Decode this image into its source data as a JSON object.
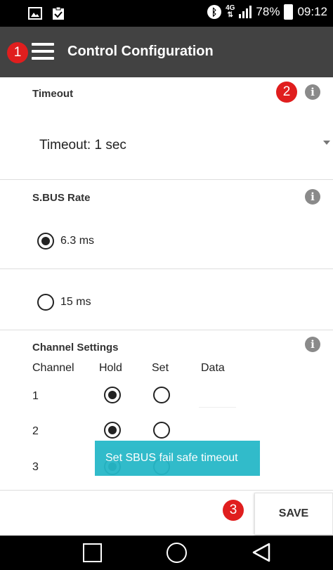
{
  "status_bar": {
    "left_icons": [
      "image-icon",
      "clipboard-check-icon"
    ],
    "bluetooth_icon": "bluetooth-icon",
    "network_label": "4G",
    "battery": "78%",
    "time": "09:12"
  },
  "app_bar": {
    "menu_icon": "hamburger-menu-icon",
    "title": "Control Configuration"
  },
  "markers": [
    "1",
    "2",
    "3"
  ],
  "timeout": {
    "title": "Timeout",
    "dropdown_value": "Timeout: 1 sec"
  },
  "sbus_rate": {
    "title": "S.BUS Rate",
    "options": [
      {
        "label": "6.3 ms",
        "checked": true
      },
      {
        "label": "15 ms",
        "checked": false
      }
    ]
  },
  "channel_settings": {
    "title": "Channel Settings",
    "headers": [
      "Channel",
      "Hold",
      "Set",
      "Data"
    ],
    "rows": [
      {
        "channel": "1",
        "hold": true,
        "set": false,
        "data": ""
      },
      {
        "channel": "2",
        "hold": true,
        "set": false,
        "data": ""
      },
      {
        "channel": "3",
        "hold": true,
        "set": false,
        "data": ""
      }
    ]
  },
  "toast": "Set SBUS fail safe timeout",
  "save_label": "SAVE",
  "colors": {
    "app_bar": "#424242",
    "marker": "#e01e1e",
    "toast": "#26b8c8",
    "info_icon": "#8a8a8a"
  }
}
